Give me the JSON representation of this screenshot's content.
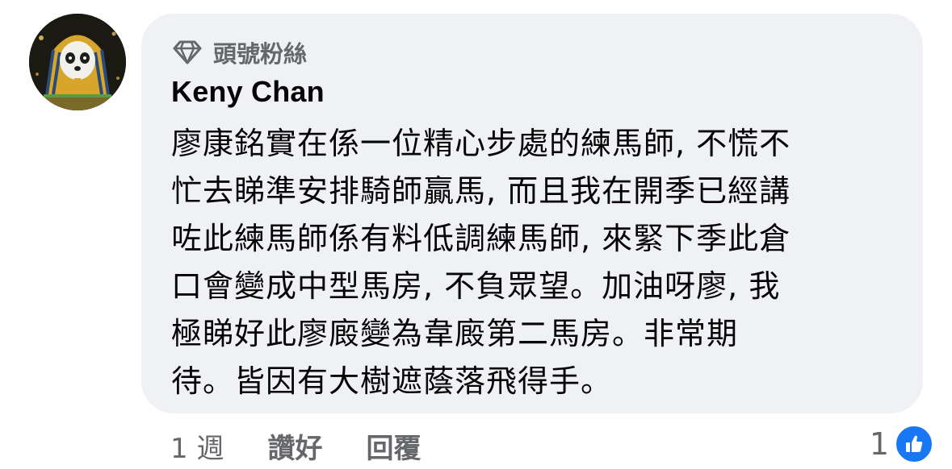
{
  "comment": {
    "badge": {
      "icon": "diamond-icon",
      "label": "頭號粉絲"
    },
    "author": "Keny Chan",
    "text": "廖康銘實在係一位精心步處的練馬師, 不慌不\n忙去睇準安排騎師贏馬, 而且我在開季已經講\n咗此練馬師係有料低調練馬師, 來緊下季此倉\n口會變成中型馬房, 不負眾望。加油呀廖, 我\n極睇好此廖廄變為韋廄第二馬房。非常期\n待。皆因有大樹遮蔭落飛得手。",
    "time": "1 週",
    "like_label": "讚好",
    "reply_label": "回覆",
    "reaction_count": "1",
    "reaction_icon": "thumbs-up-icon",
    "colors": {
      "bubble": "#eff1f4",
      "muted_text": "#65676b",
      "like_blue": "#1877f2"
    }
  }
}
